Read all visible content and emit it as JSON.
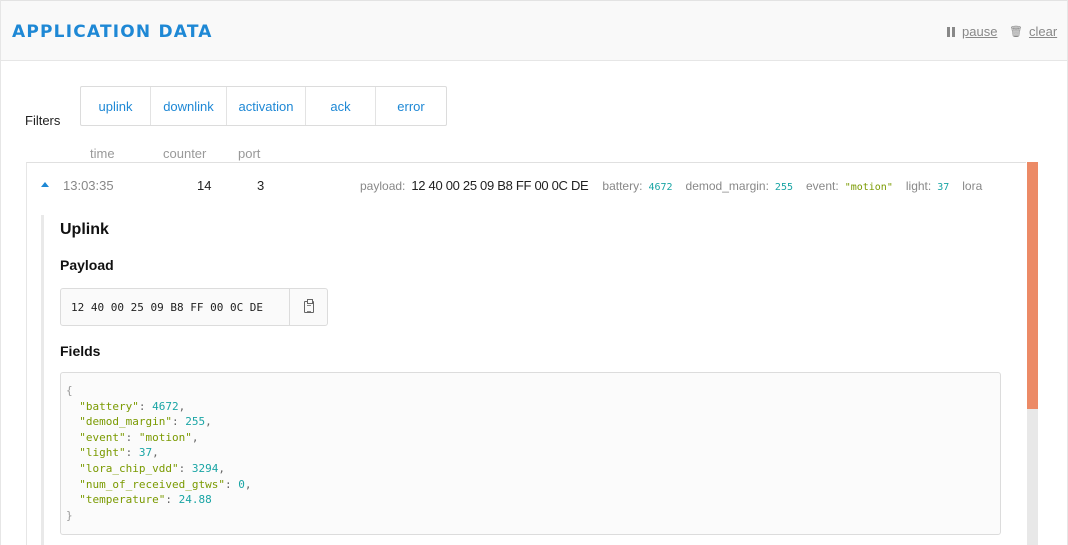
{
  "header": {
    "title": "APPLICATION DATA",
    "pause_label": "pause",
    "clear_label": "clear"
  },
  "filters": {
    "label": "Filters",
    "options": [
      "uplink",
      "downlink",
      "activation",
      "ack",
      "error"
    ]
  },
  "columns": {
    "time": "time",
    "counter": "counter",
    "port": "port"
  },
  "message": {
    "time": "13:03:35",
    "counter": "14",
    "port": "3",
    "payload_key": "payload:",
    "payload": "12 40 00 25 09 B8 FF 00 0C DE",
    "fields_summary": [
      {
        "key": "battery:",
        "value": "4672",
        "kind": "num"
      },
      {
        "key": "demod_margin:",
        "value": "255",
        "kind": "num"
      },
      {
        "key": "event:",
        "value": "\"motion\"",
        "kind": "str"
      },
      {
        "key": "light:",
        "value": "37",
        "kind": "num"
      },
      {
        "key": "lora",
        "value": "",
        "kind": "num"
      }
    ]
  },
  "detail": {
    "heading": "Uplink",
    "payload_heading": "Payload",
    "payload_hex": "12 40 00 25 09 B8 FF 00 0C DE",
    "fields_heading": "Fields",
    "json_open": "{",
    "json_close": "}",
    "json_fields": [
      {
        "key": "\"battery\"",
        "value": "4672",
        "kind": "num",
        "sep": ","
      },
      {
        "key": "\"demod_margin\"",
        "value": "255",
        "kind": "num",
        "sep": ","
      },
      {
        "key": "\"event\"",
        "value": "\"motion\"",
        "kind": "str",
        "sep": ","
      },
      {
        "key": "\"light\"",
        "value": "37",
        "kind": "num",
        "sep": ","
      },
      {
        "key": "\"lora_chip_vdd\"",
        "value": "3294",
        "kind": "num",
        "sep": ","
      },
      {
        "key": "\"num_of_received_gtws\"",
        "value": "0",
        "kind": "num",
        "sep": ","
      },
      {
        "key": "\"temperature\"",
        "value": "24.88",
        "kind": "num",
        "sep": ""
      }
    ]
  },
  "icons": {
    "pause": "pause-icon",
    "clear": "trash-icon",
    "copy": "clipboard-icon",
    "expand": "caret-up-icon"
  },
  "colors": {
    "accent": "#1e88d5",
    "scroll_thumb": "#ec8a66",
    "json_number": "#1aa5a5",
    "json_string": "#7a9a01"
  }
}
